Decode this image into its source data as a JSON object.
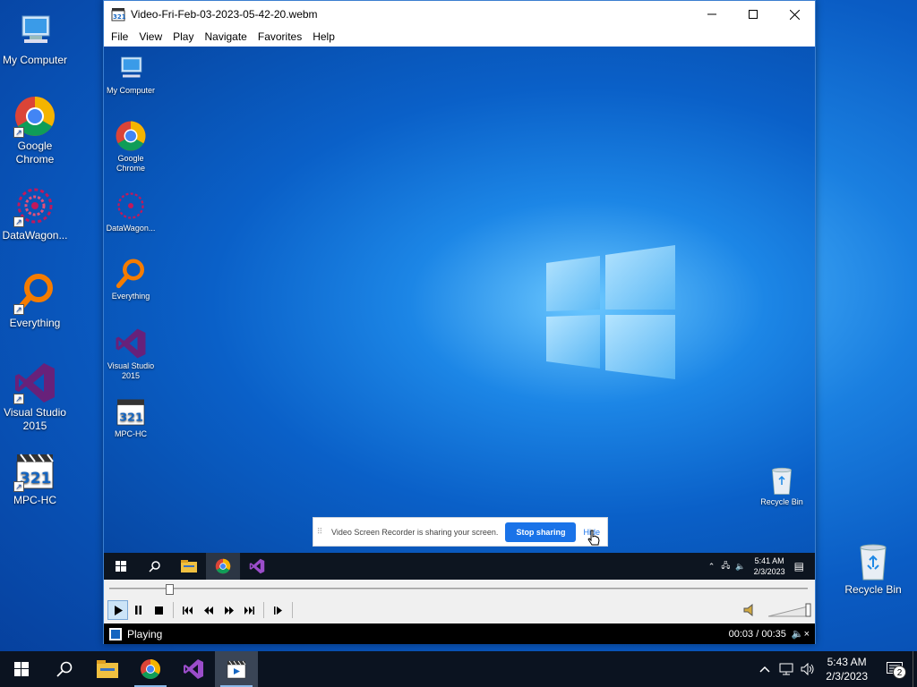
{
  "desktop": {
    "icons": [
      {
        "label": "My Computer",
        "icon": "computer-icon"
      },
      {
        "label": "Google Chrome",
        "icon": "chrome-icon"
      },
      {
        "label": "DataWagon...",
        "icon": "datawagon-icon"
      },
      {
        "label": "Everything",
        "icon": "everything-icon"
      },
      {
        "label": "Visual Studio 2015",
        "icon": "visual-studio-icon"
      },
      {
        "label": "MPC-HC",
        "icon": "mpc-hc-icon"
      },
      {
        "label": "Recycle Bin",
        "icon": "recycle-bin-icon"
      }
    ]
  },
  "window": {
    "title": "Video-Fri-Feb-03-2023-05-42-20.webm",
    "menu": [
      "File",
      "View",
      "Play",
      "Navigate",
      "Favorites",
      "Help"
    ],
    "video": {
      "icons": [
        {
          "label": "My Computer"
        },
        {
          "label": "Google Chrome"
        },
        {
          "label": "DataWagon..."
        },
        {
          "label": "Everything"
        },
        {
          "label": "Visual Studio 2015"
        },
        {
          "label": "MPC-HC"
        },
        {
          "label": "Recycle Bin"
        }
      ],
      "notification": {
        "text": "Video Screen Recorder is sharing your screen.",
        "stop_label": "Stop sharing",
        "hide_label": "Hide"
      },
      "taskbar": {
        "time": "5:41 AM",
        "date": "2/3/2023"
      }
    },
    "seek": {
      "position_fraction": 0.086
    },
    "controls": [
      "play-icon",
      "pause-icon",
      "stop-icon",
      "prev-icon",
      "rewind-icon",
      "forward-icon",
      "next-icon",
      "frame-step-icon"
    ],
    "status": {
      "state": "Playing",
      "time": "00:03 / 00:35"
    }
  },
  "taskbar": {
    "time": "5:43 AM",
    "date": "2/3/2023",
    "notification_count": "2"
  },
  "colors": {
    "accent": "#1a73e8",
    "taskbar": "#0b1320",
    "desktop": "#0a5cc4"
  }
}
